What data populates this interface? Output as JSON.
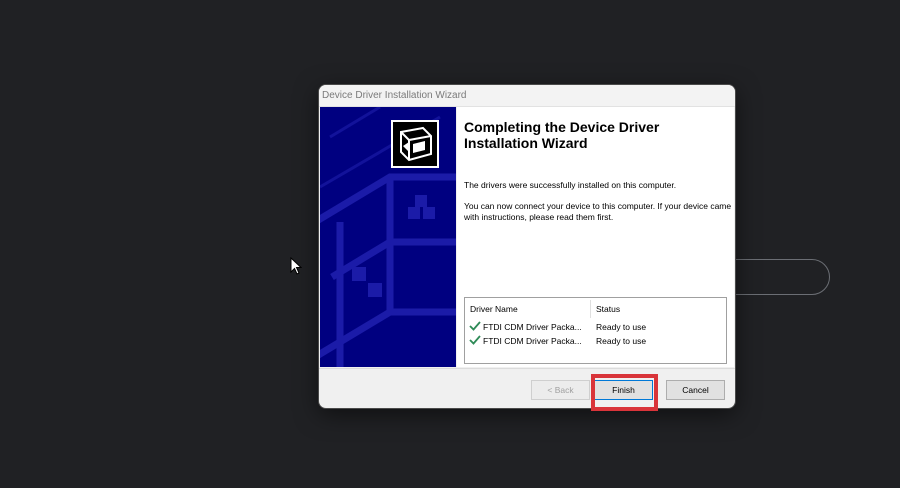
{
  "dialog": {
    "title": "Device Driver Installation Wizard",
    "heading": "Completing the Device Driver Installation Wizard",
    "message_installed": "The drivers were successfully installed on this computer.",
    "message_connect": "You can now connect your device to this computer. If your device came with instructions, please read them first."
  },
  "driver_table": {
    "columns": [
      "Driver Name",
      "Status"
    ],
    "rows": [
      {
        "name": "FTDI CDM Driver Packa...",
        "status": "Ready to use"
      },
      {
        "name": "FTDI CDM Driver Packa...",
        "status": "Ready to use"
      }
    ]
  },
  "buttons": {
    "back": "< Back",
    "finish": "Finish",
    "cancel": "Cancel"
  },
  "colors": {
    "desktop_background": "#202124",
    "wizard_banner": "#000080",
    "checkmark": "#2e8b57",
    "highlight": "#d9343a"
  },
  "icons": [
    "mouse-pointer-icon",
    "wizard-device-icon",
    "checkmark-icon"
  ]
}
